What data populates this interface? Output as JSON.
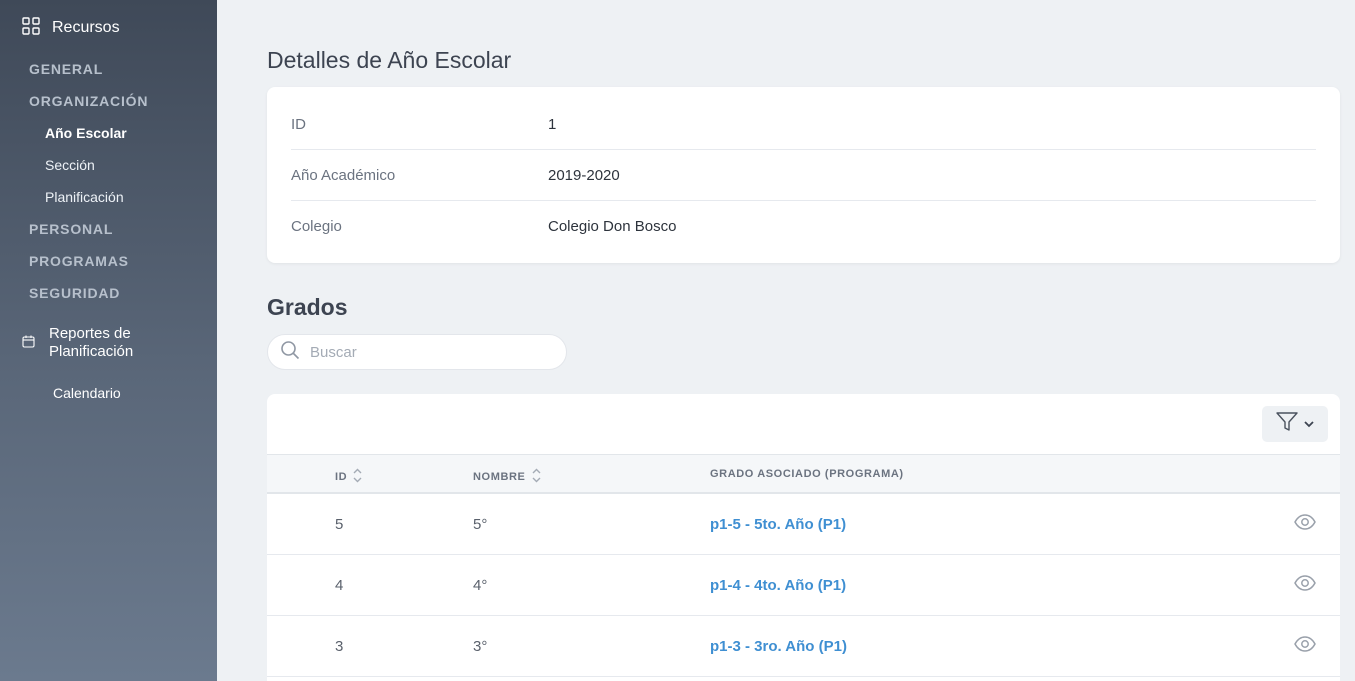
{
  "sidebar": {
    "header": "Recursos",
    "sections": {
      "general": "GENERAL",
      "organizacion": "ORGANIZACIÓN",
      "personal": "PERSONAL",
      "programas": "PROGRAMAS",
      "seguridad": "SEGURIDAD"
    },
    "org_items": [
      "Año Escolar",
      "Sección",
      "Planificación"
    ],
    "active_item": "Año Escolar",
    "reports": "Reportes de Planificación",
    "calendar": "Calendario"
  },
  "details": {
    "title": "Detalles de Año Escolar",
    "rows": [
      {
        "label": "ID",
        "value": "1"
      },
      {
        "label": "Año Académico",
        "value": "2019-2020"
      },
      {
        "label": "Colegio",
        "value": "Colegio Don Bosco"
      }
    ]
  },
  "grades": {
    "title": "Grados",
    "search_placeholder": "Buscar",
    "columns": {
      "id": "ID",
      "name": "NOMBRE",
      "grade": "GRADO ASOCIADO (PROGRAMA)"
    },
    "rows": [
      {
        "id": "5",
        "name": "5°",
        "grade": "p1-5 - 5to. Año (P1)"
      },
      {
        "id": "4",
        "name": "4°",
        "grade": "p1-4 - 4to. Año (P1)"
      },
      {
        "id": "3",
        "name": "3°",
        "grade": "p1-3 - 3ro. Año (P1)"
      }
    ]
  },
  "colors": {
    "sidebar_top": "#3f4958",
    "sidebar_bottom": "#6b7a8e",
    "background": "#eef1f4",
    "link": "#3f8fd2"
  },
  "icons": {
    "sidebar_header": "grid-icon",
    "reports": "calendar-icon",
    "search": "search-icon",
    "filter": "filter-icon",
    "row_action": "eye-icon"
  }
}
